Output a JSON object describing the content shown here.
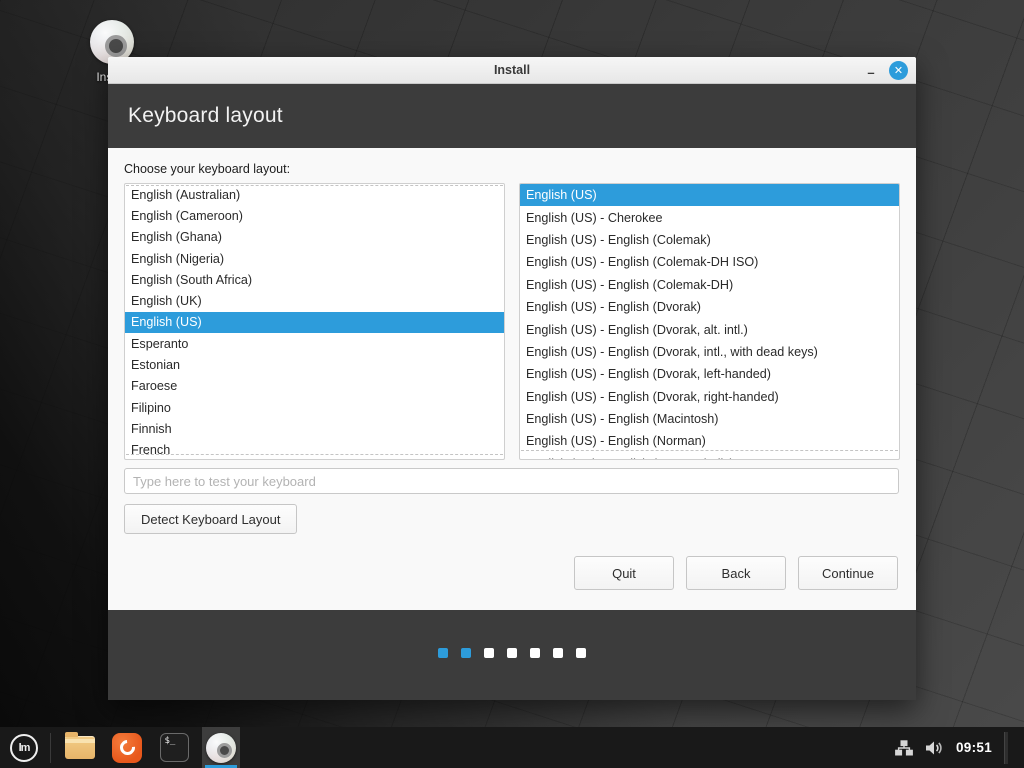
{
  "desktop": {
    "install_icon_label": "Install"
  },
  "window": {
    "title": "Install",
    "minimize_glyph": "–",
    "close_glyph": "✕",
    "header": "Keyboard layout",
    "choose_label": "Choose your keyboard layout:",
    "layout_list": {
      "selected_index": 6,
      "items": [
        "English (Australian)",
        "English (Cameroon)",
        "English (Ghana)",
        "English (Nigeria)",
        "English (South Africa)",
        "English (UK)",
        "English (US)",
        "Esperanto",
        "Estonian",
        "Faroese",
        "Filipino",
        "Finnish",
        "French"
      ]
    },
    "variant_list": {
      "selected_index": 0,
      "items": [
        "English (US)",
        "English (US) - Cherokee",
        "English (US) - English (Colemak)",
        "English (US) - English (Colemak-DH ISO)",
        "English (US) - English (Colemak-DH)",
        "English (US) - English (Dvorak)",
        "English (US) - English (Dvorak, alt. intl.)",
        "English (US) - English (Dvorak, intl., with dead keys)",
        "English (US) - English (Dvorak, left-handed)",
        "English (US) - English (Dvorak, right-handed)",
        "English (US) - English (Macintosh)",
        "English (US) - English (Norman)",
        "English (US) - English (US-Symbolic)"
      ]
    },
    "test_input": {
      "value": "",
      "placeholder": "Type here to test your keyboard"
    },
    "detect_button": "Detect Keyboard Layout",
    "buttons": {
      "quit": "Quit",
      "back": "Back",
      "continue": "Continue"
    },
    "progress": {
      "total": 7,
      "completed": 2
    }
  },
  "taskbar": {
    "menu_logo_text": "lm",
    "terminal_glyph": "$_",
    "clock": "09:51"
  },
  "colors": {
    "accent": "#2d9cdb",
    "header_bg": "#3c3c3c",
    "taskbar_bg": "#191919",
    "selected_row_bg": "#2d9cdb",
    "close_button": "#2d9cdb"
  }
}
